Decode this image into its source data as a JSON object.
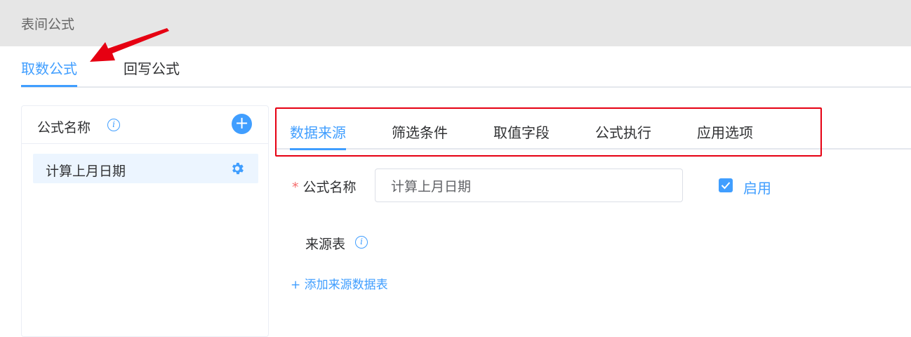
{
  "header": {
    "title": "表间公式"
  },
  "main_tabs": [
    {
      "label": "取数公式",
      "active": true
    },
    {
      "label": "回写公式",
      "active": false
    }
  ],
  "formula_list": {
    "header_label": "公式名称",
    "items": [
      {
        "name": "计算上月日期"
      }
    ]
  },
  "sub_tabs": [
    {
      "label": "数据来源",
      "active": true
    },
    {
      "label": "筛选条件",
      "active": false
    },
    {
      "label": "取值字段",
      "active": false
    },
    {
      "label": "公式执行",
      "active": false
    },
    {
      "label": "应用选项",
      "active": false
    }
  ],
  "form": {
    "name_label": "公式名称",
    "required_mark": "*",
    "name_value": "计算上月日期",
    "enable_label": "启用",
    "enable_checked": true,
    "source_label": "来源表",
    "add_source_link": "+ 添加来源数据表"
  },
  "colors": {
    "accent": "#409eff",
    "highlight_box": "#e60012",
    "annotation_arrow": "#e60012"
  },
  "icons": [
    "info-icon",
    "plus-icon",
    "gear-icon",
    "checkmark-icon",
    "annotation-arrow"
  ]
}
